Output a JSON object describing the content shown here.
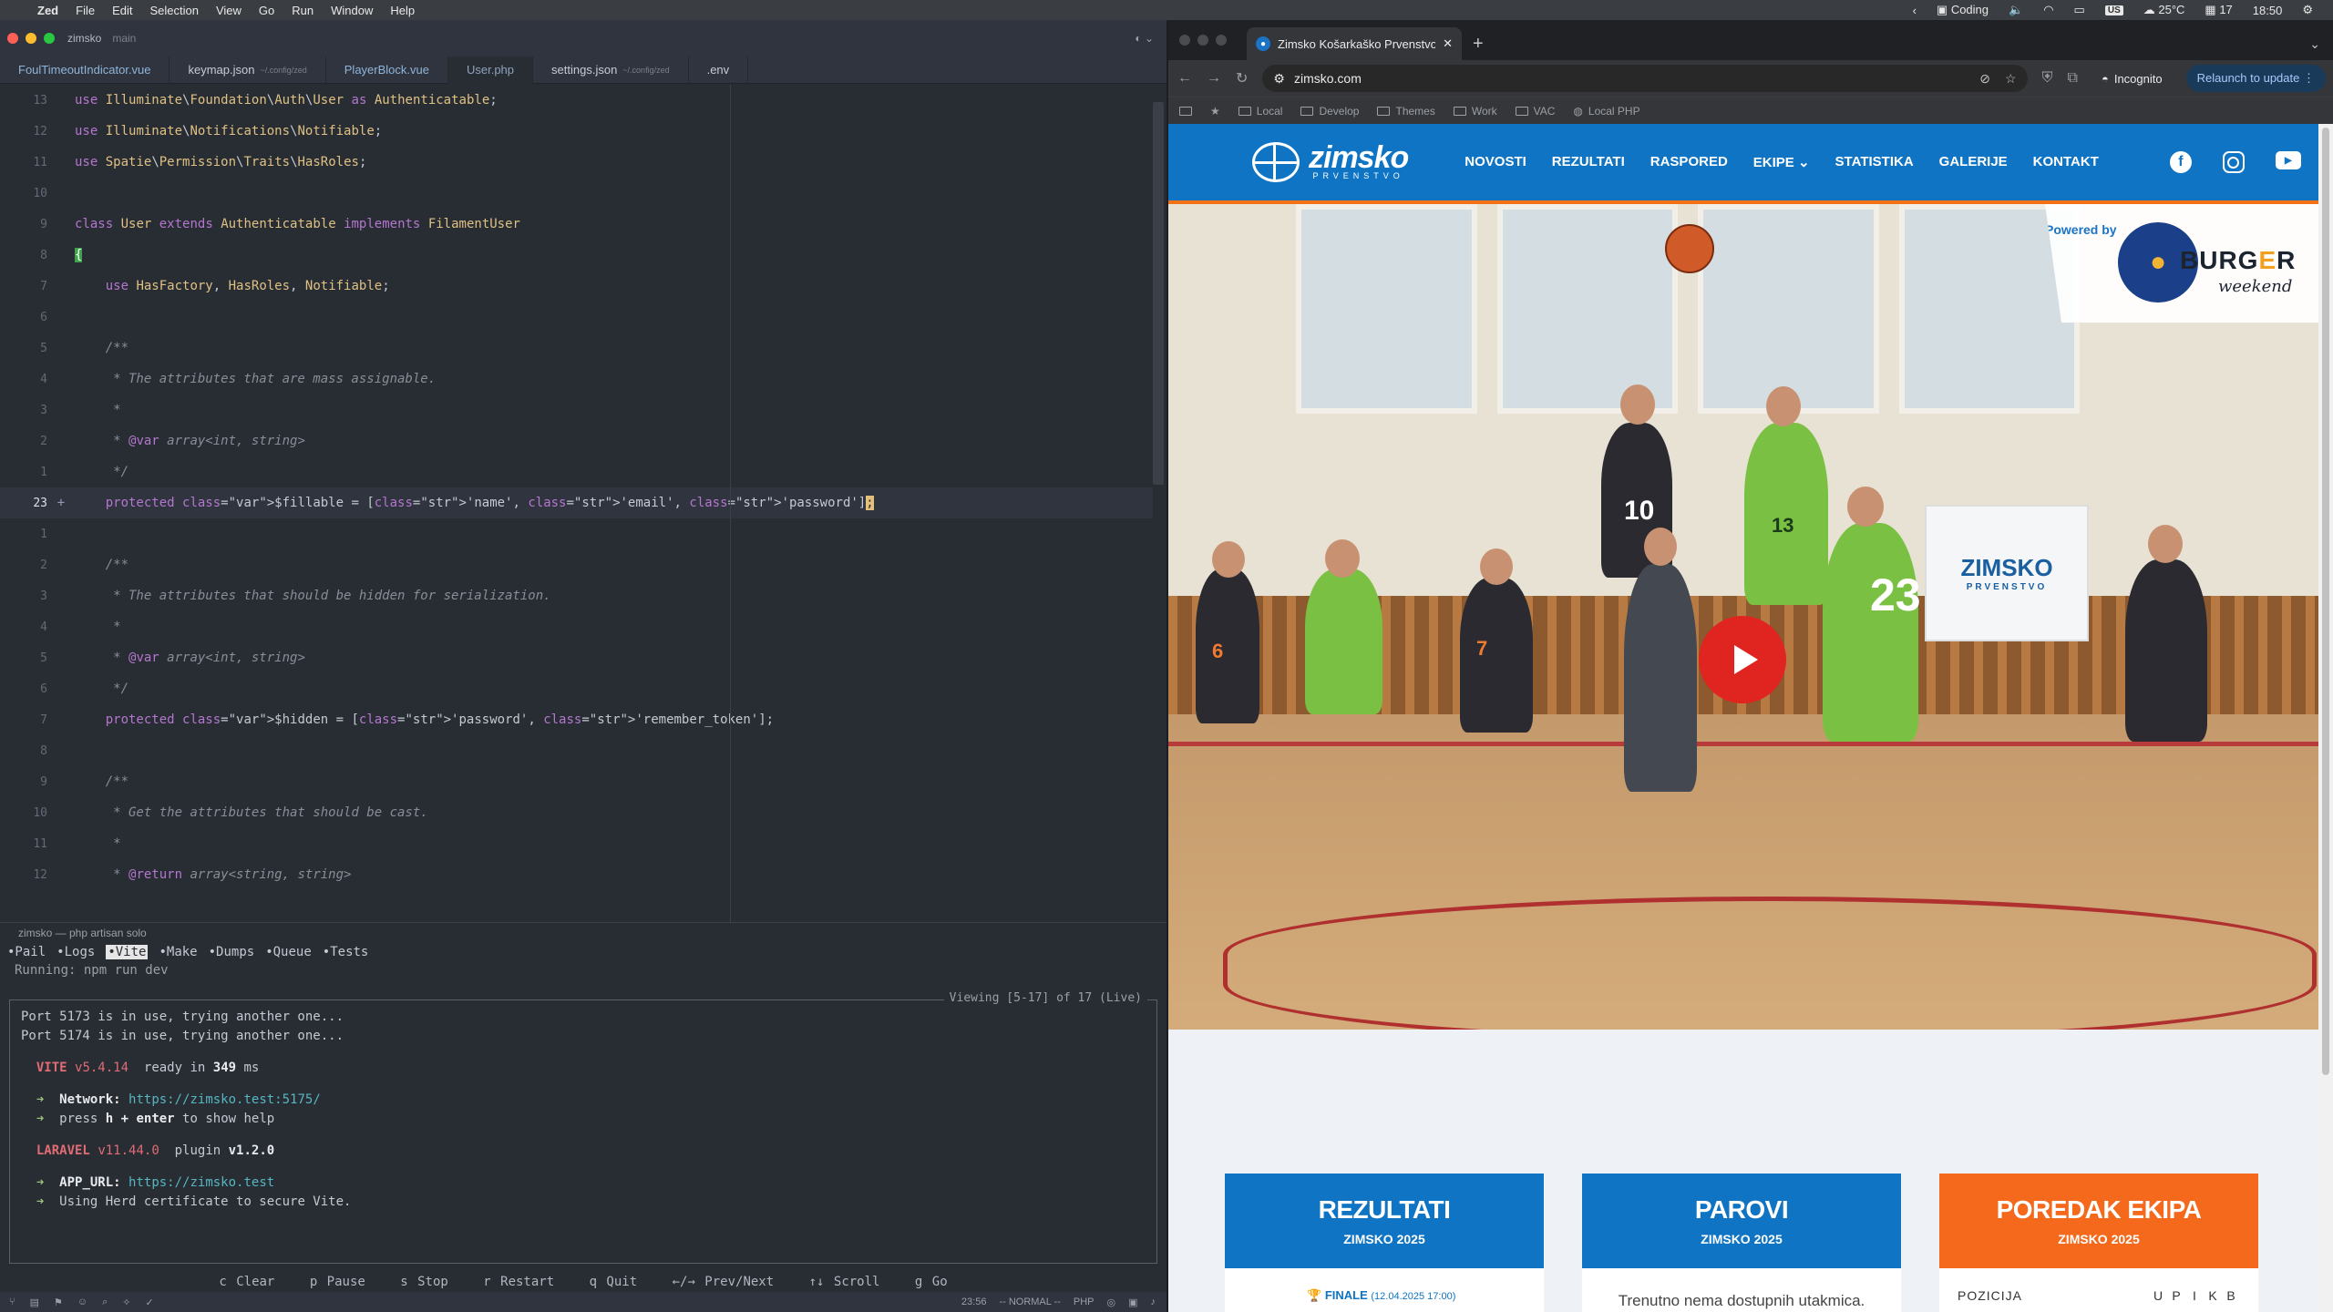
{
  "menubar": {
    "app": "Zed",
    "menus": [
      "File",
      "Edit",
      "Selection",
      "View",
      "Go",
      "Run",
      "Window",
      "Help"
    ],
    "status": {
      "focus": "Coding",
      "input": "US",
      "weather": "25°C",
      "calendar": "17",
      "time": "18:50"
    }
  },
  "editor": {
    "project": "zimsko",
    "branch": "main",
    "tabs": [
      {
        "label": "FoulTimeoutIndicator.vue",
        "path": ""
      },
      {
        "label": "keymap.json",
        "path": "~/.config/zed"
      },
      {
        "label": "PlayerBlock.vue",
        "path": ""
      },
      {
        "label": "User.php",
        "path": ""
      },
      {
        "label": "settings.json",
        "path": "~/.config/zed"
      },
      {
        "label": ".env",
        "path": ""
      }
    ],
    "line_numbers": [
      "13",
      "12",
      "11",
      "10",
      "9",
      "8",
      "7",
      "6",
      "5",
      "4",
      "3",
      "2",
      "1",
      "23",
      "1",
      "2",
      "3",
      "4",
      "5",
      "6",
      "7",
      "8",
      "9",
      "10",
      "11",
      "12"
    ],
    "code": [
      "use Illuminate\\Foundation\\Auth\\User as Authenticatable;",
      "use Illuminate\\Notifications\\Notifiable;",
      "use Spatie\\Permission\\Traits\\HasRoles;",
      "",
      "class User extends Authenticatable implements FilamentUser",
      "{",
      "    use HasFactory, HasRoles, Notifiable;",
      "",
      "    /**",
      "     * The attributes that are mass assignable.",
      "     *",
      "     * @var array<int, string>",
      "     */",
      "    protected $fillable = ['name', 'email', 'password'];",
      "",
      "    /**",
      "     * The attributes that should be hidden for serialization.",
      "     *",
      "     * @var array<int, string>",
      "     */",
      "    protected $hidden = ['password', 'remember_token'];",
      "",
      "    /**",
      "     * Get the attributes that should be cast.",
      "     *",
      "     * @return array<string, string>"
    ]
  },
  "terminal": {
    "title": "zimsko — php artisan solo",
    "tabs": [
      "•Pail",
      "•Logs",
      "•Vite",
      "•Make",
      "•Dumps",
      "•Queue",
      "•Tests"
    ],
    "running": "Running: npm run dev",
    "viewing": "Viewing [5-17] of 17 (Live)",
    "port1": "Port 5173 is in use, trying another one...",
    "port2": "Port 5174 is in use, trying another one...",
    "vite_name": "VITE",
    "vite_ver": "v5.4.14",
    "vite_ready": "ready in",
    "vite_ms": "349",
    "vite_ms_unit": "ms",
    "network_label": "Network:",
    "network_url": "https://zimsko.test:5175/",
    "help_press": "press",
    "help_keys": "h + enter",
    "help_rest": "to show help",
    "laravel": "LARAVEL",
    "laravel_ver": "v11.44.0",
    "plugin_label": "plugin",
    "plugin_ver": "v1.2.0",
    "appurl_label": "APP_URL:",
    "appurl": "https://zimsko.test",
    "herd": "Using Herd certificate to secure Vite.",
    "help": [
      "c Clear",
      "p Pause",
      "s Stop",
      "r Restart",
      "q Quit",
      "←/→ Prev/Next",
      "↑↓ Scroll",
      "g Go"
    ]
  },
  "statusbar": {
    "pos": "23:56",
    "mode": "-- NORMAL --",
    "lang": "PHP"
  },
  "browser": {
    "tab_title": "Zimsko Košarkaško Prvenstvo",
    "url": "zimsko.com",
    "incognito": "Incognito",
    "relaunch": "Relaunch to update",
    "bookmarks": [
      "Local",
      "Develop",
      "Themes",
      "Work",
      "VAC",
      "Local PHP"
    ]
  },
  "site": {
    "logo_main": "zimsko",
    "logo_sub": "PRVENSTVO",
    "nav": [
      "NOVOSTI",
      "REZULTATI",
      "RASPORED",
      "EKIPE ⌄",
      "STATISTIKA",
      "GALERIJE",
      "KONTAKT"
    ],
    "powered_by": "Powered by",
    "sponsor_a": "BURG",
    "sponsor_b": "E",
    "sponsor_c": "R",
    "sponsor_d": "weekend",
    "banner_main": "ZIMSKO",
    "banner_sub": "PRVENSTVO",
    "cards": [
      {
        "title": "REZULTATI",
        "sub": "ZIMSKO 2025",
        "final": "FINALE",
        "final_date": "(12.04.2025 17:00)"
      },
      {
        "title": "PAROVI",
        "sub": "ZIMSKO 2025",
        "empty": "Trenutno nema dostupnih utakmica."
      },
      {
        "title": "POREDAK EKIPA",
        "sub": "ZIMSKO 2025",
        "cols": [
          "POZICIJA",
          "U",
          "P",
          "I",
          "K",
          "B"
        ]
      }
    ]
  },
  "colors": {
    "site_blue": "#0e74c3",
    "site_orange": "#f4691b",
    "editor_bg": "#282c33"
  }
}
